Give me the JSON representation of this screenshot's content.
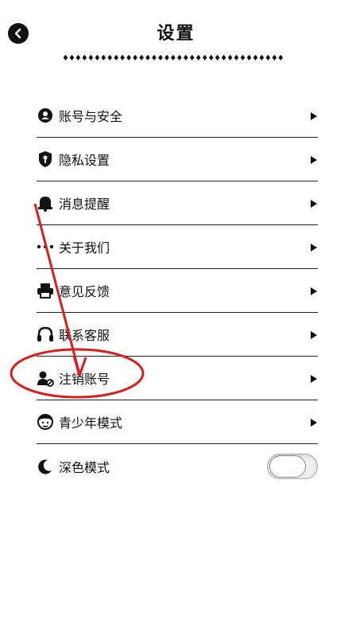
{
  "header": {
    "title": "设置",
    "decoration": "♦♦♦♦♦♦♦♦♦♦♦♦♦♦♦♦♦♦♦♦♦♦♦♦♦♦♦♦♦♦♦♦♦♦♦"
  },
  "settings": {
    "items": [
      {
        "label": "账号与安全",
        "icon": "user-lock-icon"
      },
      {
        "label": "隐私设置",
        "icon": "shield-key-icon"
      },
      {
        "label": "消息提醒",
        "icon": "bell-icon"
      },
      {
        "label": "关于我们",
        "icon": "dots-icon"
      },
      {
        "label": "意见反馈",
        "icon": "printer-icon"
      },
      {
        "label": "联系客服",
        "icon": "headset-icon"
      },
      {
        "label": "注销账号",
        "icon": "user-block-icon"
      },
      {
        "label": "青少年模式",
        "icon": "teen-face-icon"
      },
      {
        "label": "深色模式",
        "icon": "moon-icon"
      }
    ],
    "dark_mode_enabled": false
  },
  "annotation": {
    "color": "#d42020",
    "highlighted_item": "注销账号"
  }
}
